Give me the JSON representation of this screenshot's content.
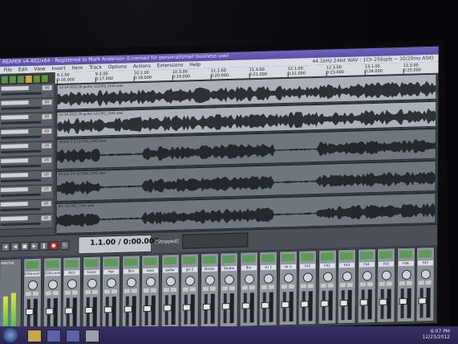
{
  "window": {
    "title": "REAPER v4.402/x64 - Registered to Mark Anderson (Licensed for personal/small business use)",
    "menu": [
      "File",
      "Edit",
      "View",
      "Insert",
      "Item",
      "Track",
      "Options",
      "Actions",
      "Extensions",
      "Help"
    ],
    "status": "44.1kHz 24bit WAV : 1Ch 256spls ~ 10/20ms ASIO"
  },
  "ruler": {
    "markers": [
      {
        "bar": "9.1.00",
        "time": "0:16.000"
      },
      {
        "bar": "9.3.00",
        "time": "0:17.000"
      },
      {
        "bar": "10.1.00",
        "time": "0:18.000"
      },
      {
        "bar": "10.3.00",
        "time": "0:19.000"
      },
      {
        "bar": "11.1.00",
        "time": "0:20.000"
      },
      {
        "bar": "11.3.00",
        "time": "0:21.000"
      },
      {
        "bar": "12.1.00",
        "time": "0:22.000"
      },
      {
        "bar": "12.3.00",
        "time": "0:23.000"
      },
      {
        "bar": "13.1.00",
        "time": "0:24.000"
      },
      {
        "bar": "13.3.00",
        "time": "0:25.000"
      }
    ]
  },
  "tracks": [
    {
      "clip": "12-14-2012 DI guitar 121302_1541.wav",
      "color": "#aab1b8"
    },
    {
      "clip": "12-14-2012 DI guitar 121302_1541.wav",
      "color": "#aab1b8"
    },
    {
      "clip": "Strobe 1-2 121302_1541.wav",
      "color": "#6f777e"
    },
    {
      "clip": "Strobe 3-4 121302_1541.wav",
      "color": "#6f777e"
    },
    {
      "clip": "Rm 121302_1541.wav",
      "color": "#6f777e"
    }
  ],
  "track_panel": [
    {
      "io": "I/O"
    },
    {
      "io": "I/O"
    },
    {
      "io": "I/O"
    },
    {
      "io": "I/O"
    },
    {
      "io": "I/O"
    },
    {
      "io": "I/O"
    },
    {
      "io": "I/O"
    },
    {
      "io": "I/O"
    },
    {
      "io": "I/O"
    },
    {
      "io": "I/O"
    }
  ],
  "transport": {
    "time": "1.1.00 / 0:00.000",
    "state": "[Stopped]"
  },
  "mixer": {
    "master_label": "MASTER",
    "strips": [
      "EZdrummer",
      "EZdrummer",
      "Kick",
      "Snare",
      "Hat",
      "Tom",
      "bass",
      "guitar",
      "gtr 2",
      "Strobe",
      "Strobe",
      "Rm",
      "str 1",
      "str 2",
      "FX1",
      "FX2",
      "FX3",
      "FX4",
      "FX5",
      "FX6",
      "FX7"
    ]
  },
  "taskbar": {
    "time": "6:07 PM",
    "date": "12/23/2012"
  }
}
